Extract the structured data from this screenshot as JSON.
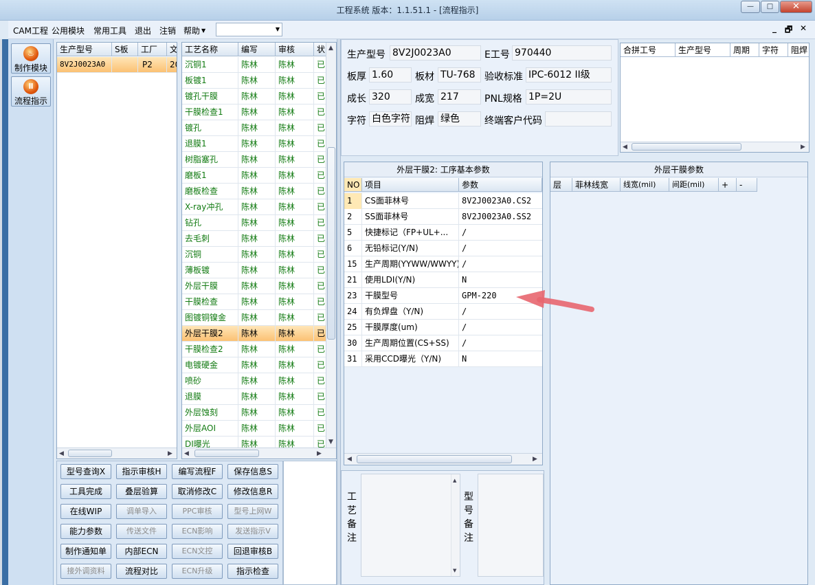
{
  "window": {
    "title": "工程系统   版本：1.1.51.1 - [流程指示]",
    "min": "—",
    "max": "□",
    "close": "✕"
  },
  "menu": {
    "items": [
      "CAM工程",
      "公用模块",
      "常用工具",
      "退出",
      "注销",
      "帮助"
    ],
    "combo_value": "",
    "mdi": [
      "_",
      "🗗",
      "✕"
    ]
  },
  "side": {
    "buttons": [
      {
        "label": "制作模块",
        "icon": "fire-icon"
      },
      {
        "label": "流程指示",
        "icon": "pause-icon"
      }
    ]
  },
  "model_grid": {
    "headers": [
      "生产型号",
      "S板",
      "工厂",
      "文"
    ],
    "rows": [
      [
        "8V2J0023A0",
        "",
        "P2",
        "20"
      ]
    ]
  },
  "process_grid": {
    "headers": [
      "工艺名称",
      "编写",
      "审核",
      "状"
    ],
    "rows": [
      [
        "沉铜1",
        "陈林",
        "陈林",
        "已"
      ],
      [
        "板镀1",
        "陈林",
        "陈林",
        "已"
      ],
      [
        "镀孔干膜",
        "陈林",
        "陈林",
        "已"
      ],
      [
        "干膜检查1",
        "陈林",
        "陈林",
        "已"
      ],
      [
        "镀孔",
        "陈林",
        "陈林",
        "已"
      ],
      [
        "退膜1",
        "陈林",
        "陈林",
        "已"
      ],
      [
        "树脂塞孔",
        "陈林",
        "陈林",
        "已"
      ],
      [
        "磨板1",
        "陈林",
        "陈林",
        "已"
      ],
      [
        "磨板检查",
        "陈林",
        "陈林",
        "已"
      ],
      [
        "X-ray冲孔",
        "陈林",
        "陈林",
        "已"
      ],
      [
        "钻孔",
        "陈林",
        "陈林",
        "已"
      ],
      [
        "去毛刺",
        "陈林",
        "陈林",
        "已"
      ],
      [
        "沉铜",
        "陈林",
        "陈林",
        "已"
      ],
      [
        "薄板镀",
        "陈林",
        "陈林",
        "已"
      ],
      [
        "外层干膜",
        "陈林",
        "陈林",
        "已"
      ],
      [
        "干膜检查",
        "陈林",
        "陈林",
        "已"
      ],
      [
        "图镀铜镍金",
        "陈林",
        "陈林",
        "已"
      ],
      [
        "外层干膜2",
        "陈林",
        "陈林",
        "已"
      ],
      [
        "干膜检查2",
        "陈林",
        "陈林",
        "已"
      ],
      [
        "电镀硬金",
        "陈林",
        "陈林",
        "已"
      ],
      [
        "喷砂",
        "陈林",
        "陈林",
        "已"
      ],
      [
        "退膜",
        "陈林",
        "陈林",
        "已"
      ],
      [
        "外层蚀刻",
        "陈林",
        "陈林",
        "已"
      ],
      [
        "外层AOI",
        "陈林",
        "陈林",
        "已"
      ],
      [
        "DI曝光",
        "陈林",
        "陈林",
        "已"
      ]
    ],
    "selected_index": 17
  },
  "buttons": [
    [
      "型号查询X",
      "指示审核H",
      "编写流程F",
      "保存信息S"
    ],
    [
      "工具完成",
      "叠层验算",
      "取消修改C",
      "修改信息R"
    ],
    [
      "在线WIP",
      "调单导入",
      "PPC审核",
      "型号上网W"
    ],
    [
      "能力参数",
      "传送文件",
      "ECN影响",
      "发送指示V"
    ],
    [
      "制作通知单",
      "内部ECN",
      "ECN文控",
      "回退审核B"
    ],
    [
      "接外调资料",
      "流程对比",
      "ECN升级",
      "指示检查"
    ]
  ],
  "buttons_disabled": [
    [
      false,
      false,
      false,
      false
    ],
    [
      false,
      false,
      false,
      false
    ],
    [
      false,
      true,
      true,
      true
    ],
    [
      false,
      true,
      true,
      true
    ],
    [
      false,
      false,
      true,
      false
    ],
    [
      true,
      false,
      true,
      false
    ]
  ],
  "info": {
    "labels": [
      "生产型号",
      "E工号",
      "板厚",
      "板材",
      "验收标准",
      "成长",
      "成宽",
      "PNL规格",
      "字符",
      "阻焊",
      "终端客户代码"
    ],
    "values": {
      "model": "8V2J0023A0",
      "eno": "970440",
      "thickness": "1.60",
      "material": "TU-768",
      "standard": "IPC-6012 II级",
      "length": "320",
      "width": "217",
      "pnl": "1P=2U",
      "char": "白色字符",
      "mask": "绿色",
      "customer": ""
    }
  },
  "merge_grid": {
    "headers": [
      "合拼工号",
      "生产型号",
      "周期",
      "字符",
      "阻焊"
    ]
  },
  "param_panel": {
    "title": "外层干膜2: 工序基本参数",
    "headers": [
      "NO",
      "项目",
      "参数"
    ],
    "rows": [
      [
        "1",
        "CS面菲林号",
        "8V2J0023A0.CS2"
      ],
      [
        "2",
        "SS面菲林号",
        "8V2J0023A0.SS2"
      ],
      [
        "5",
        "快捷标记（FP+UL+...",
        "/"
      ],
      [
        "6",
        "无铅标记(Y/N)",
        "/"
      ],
      [
        "15",
        "生产周期(YYWW/WWYY)",
        "/"
      ],
      [
        "21",
        "使用LDI(Y/N)",
        "N"
      ],
      [
        "23",
        "干膜型号",
        "GPM-220"
      ],
      [
        "24",
        "有负焊盘（Y/N)",
        "/"
      ],
      [
        "25",
        "干膜厚度(um)",
        "/"
      ],
      [
        "30",
        "生产周期位置(CS+SS)",
        "/"
      ],
      [
        "31",
        "采用CCD曝光（Y/N)",
        "N"
      ]
    ]
  },
  "film_panel": {
    "title": "外层干膜参数",
    "headers": [
      "层",
      "菲林线宽",
      "线宽(mil)",
      "间距(mil)",
      "+",
      "-"
    ]
  },
  "notes": {
    "process_label": "工艺备注",
    "model_label": "型号备注"
  },
  "colors": {
    "accent": "#fbc173",
    "green_text": "#117a11",
    "annotation_arrow": "#e8666f"
  }
}
